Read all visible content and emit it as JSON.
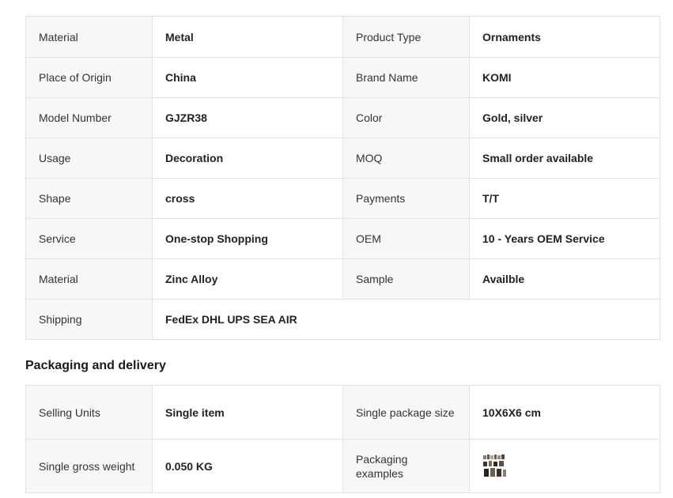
{
  "attributes": [
    {
      "k1": "Material",
      "v1": "Metal",
      "k2": "Product Type",
      "v2": "Ornaments"
    },
    {
      "k1": "Place of Origin",
      "v1": "China",
      "k2": "Brand Name",
      "v2": "KOMI"
    },
    {
      "k1": "Model Number",
      "v1": "GJZR38",
      "k2": "Color",
      "v2": "Gold, silver"
    },
    {
      "k1": "Usage",
      "v1": "Decoration",
      "k2": "MOQ",
      "v2": "Small order available"
    },
    {
      "k1": "Shape",
      "v1": "cross",
      "k2": "Payments",
      "v2": "T/T"
    },
    {
      "k1": "Service",
      "v1": "One-stop Shopping",
      "k2": "OEM",
      "v2": "10 - Years OEM Service"
    },
    {
      "k1": "Material",
      "v1": "Zinc Alloy",
      "k2": "Sample",
      "v2": "Availble"
    },
    {
      "k1": "Shipping",
      "v1": "FedEx DHL UPS SEA AIR"
    }
  ],
  "packaging": {
    "title": "Packaging and delivery",
    "rows": [
      {
        "k1": "Selling Units",
        "v1": "Single item",
        "k2": "Single package size",
        "v2": "10X6X6 cm"
      },
      {
        "k1": "Single gross weight",
        "v1": "0.050 KG",
        "k2": "Packaging examples",
        "v2_icon": "packaging-example-thumbnail"
      }
    ]
  }
}
